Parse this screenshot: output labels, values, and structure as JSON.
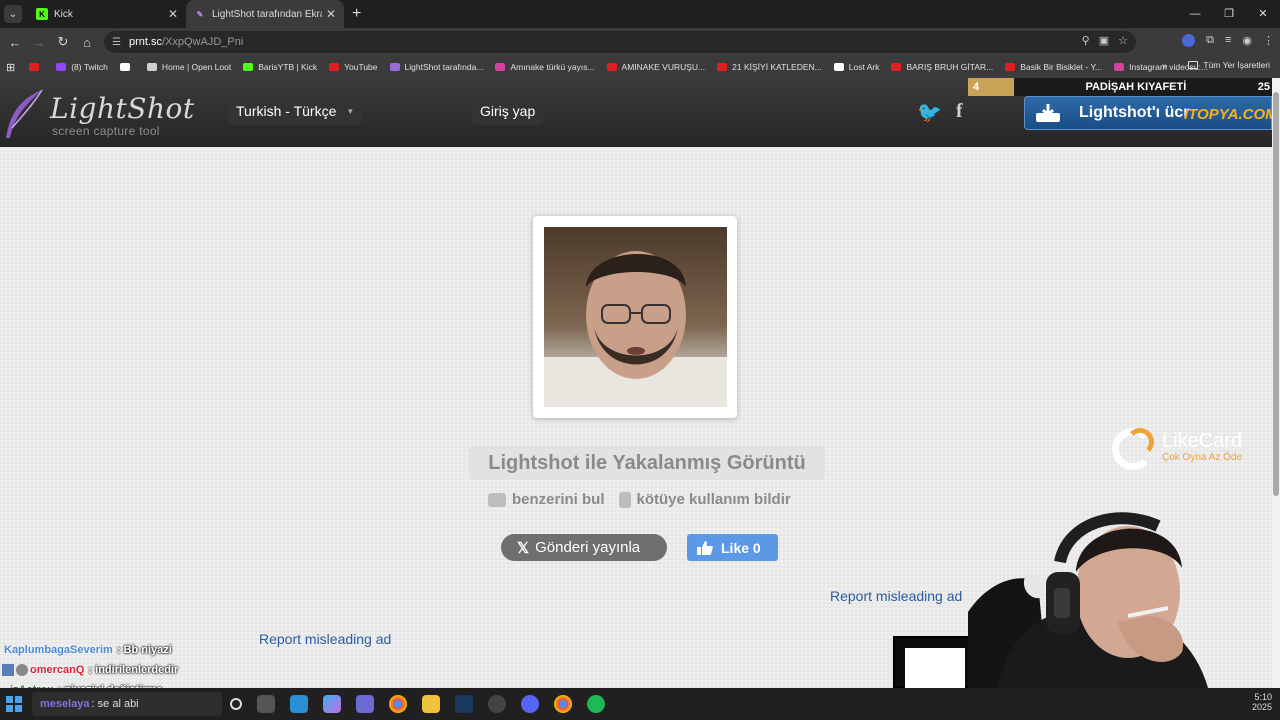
{
  "browser": {
    "tabs": [
      {
        "title": "Kick",
        "favicon_color": "#53fc18",
        "active": false
      },
      {
        "title": "LightShot tarafından Ekran Görü",
        "favicon_color": "#9b6ad6",
        "active": true
      }
    ],
    "url_host": "prnt.sc",
    "url_path": "/XxpQwAJD_Pni",
    "bookmarks": [
      {
        "label": "",
        "color": "#e02020"
      },
      {
        "label": "(8) Twitch",
        "color": "#9146ff"
      },
      {
        "label": "",
        "color": "#ffffff"
      },
      {
        "label": "Home | Open Loot",
        "color": "#d0d0d0"
      },
      {
        "label": "BarisYTB | Kick",
        "color": "#53fc18"
      },
      {
        "label": "YouTube",
        "color": "#e02020"
      },
      {
        "label": "LightShot tarafında...",
        "color": "#9b6ad6"
      },
      {
        "label": "Amınake türkü yayıs...",
        "color": "#d6409f"
      },
      {
        "label": "AMINAKE VURUŞU...",
        "color": "#e02020"
      },
      {
        "label": "21 KİŞİYİ KATLEDEN...",
        "color": "#e02020"
      },
      {
        "label": "Lost Ark",
        "color": "#ffffff"
      },
      {
        "label": "BARIŞ BRUH GİTAR...",
        "color": "#e02020"
      },
      {
        "label": "Basik Bir Bisiklet - Y...",
        "color": "#e02020"
      },
      {
        "label": "Instagram videosu:...",
        "color": "#d6409f"
      }
    ],
    "bookmarks_more": "»",
    "all_bookmarks": "Tüm Yer İşaretleri"
  },
  "header": {
    "brand": "LightShot",
    "tagline": "screen capture tool",
    "language": "Turkish - Türkçe",
    "login": "Giriş yap",
    "promo": "Lightshot'ı ücr",
    "overlay_tag": "ITOPYA.COM"
  },
  "stream_bar": {
    "left_num": "4",
    "title": "PADİŞAH KIYAFETİ",
    "right_num": "25"
  },
  "main": {
    "caption": "Lightshot ile Yakalanmış Görüntü",
    "find_similar": "benzerini bul",
    "report_abuse": "kötüye kullanım bildir",
    "tweet": "Gönderi yayınla",
    "like_label": "Like",
    "like_count": "0",
    "report_ad_1": "Report misleading ad",
    "report_ad_2": "Report misleading ad"
  },
  "likecard": {
    "name": "LikeCard",
    "slogan": "Çok Oyna Az Öde"
  },
  "chat": [
    {
      "user": "KaplumbagaSeverim",
      "message": ": Bb niyazi"
    },
    {
      "user": "omercanQ",
      "message": ": indirilenlerdedir"
    },
    {
      "user": "izAatrox",
      "message": ": niyaziyi değiştirme"
    },
    {
      "user": "meselaya",
      "message": ": se al abi"
    }
  ],
  "taskbar": {
    "time": "5:10",
    "date": "2025"
  },
  "colors": {
    "accent_blue": "#2a5ba0",
    "like_blue": "#5b98e6",
    "promo_blue": "#2d6aa9",
    "stream_gold": "#c9a458"
  }
}
